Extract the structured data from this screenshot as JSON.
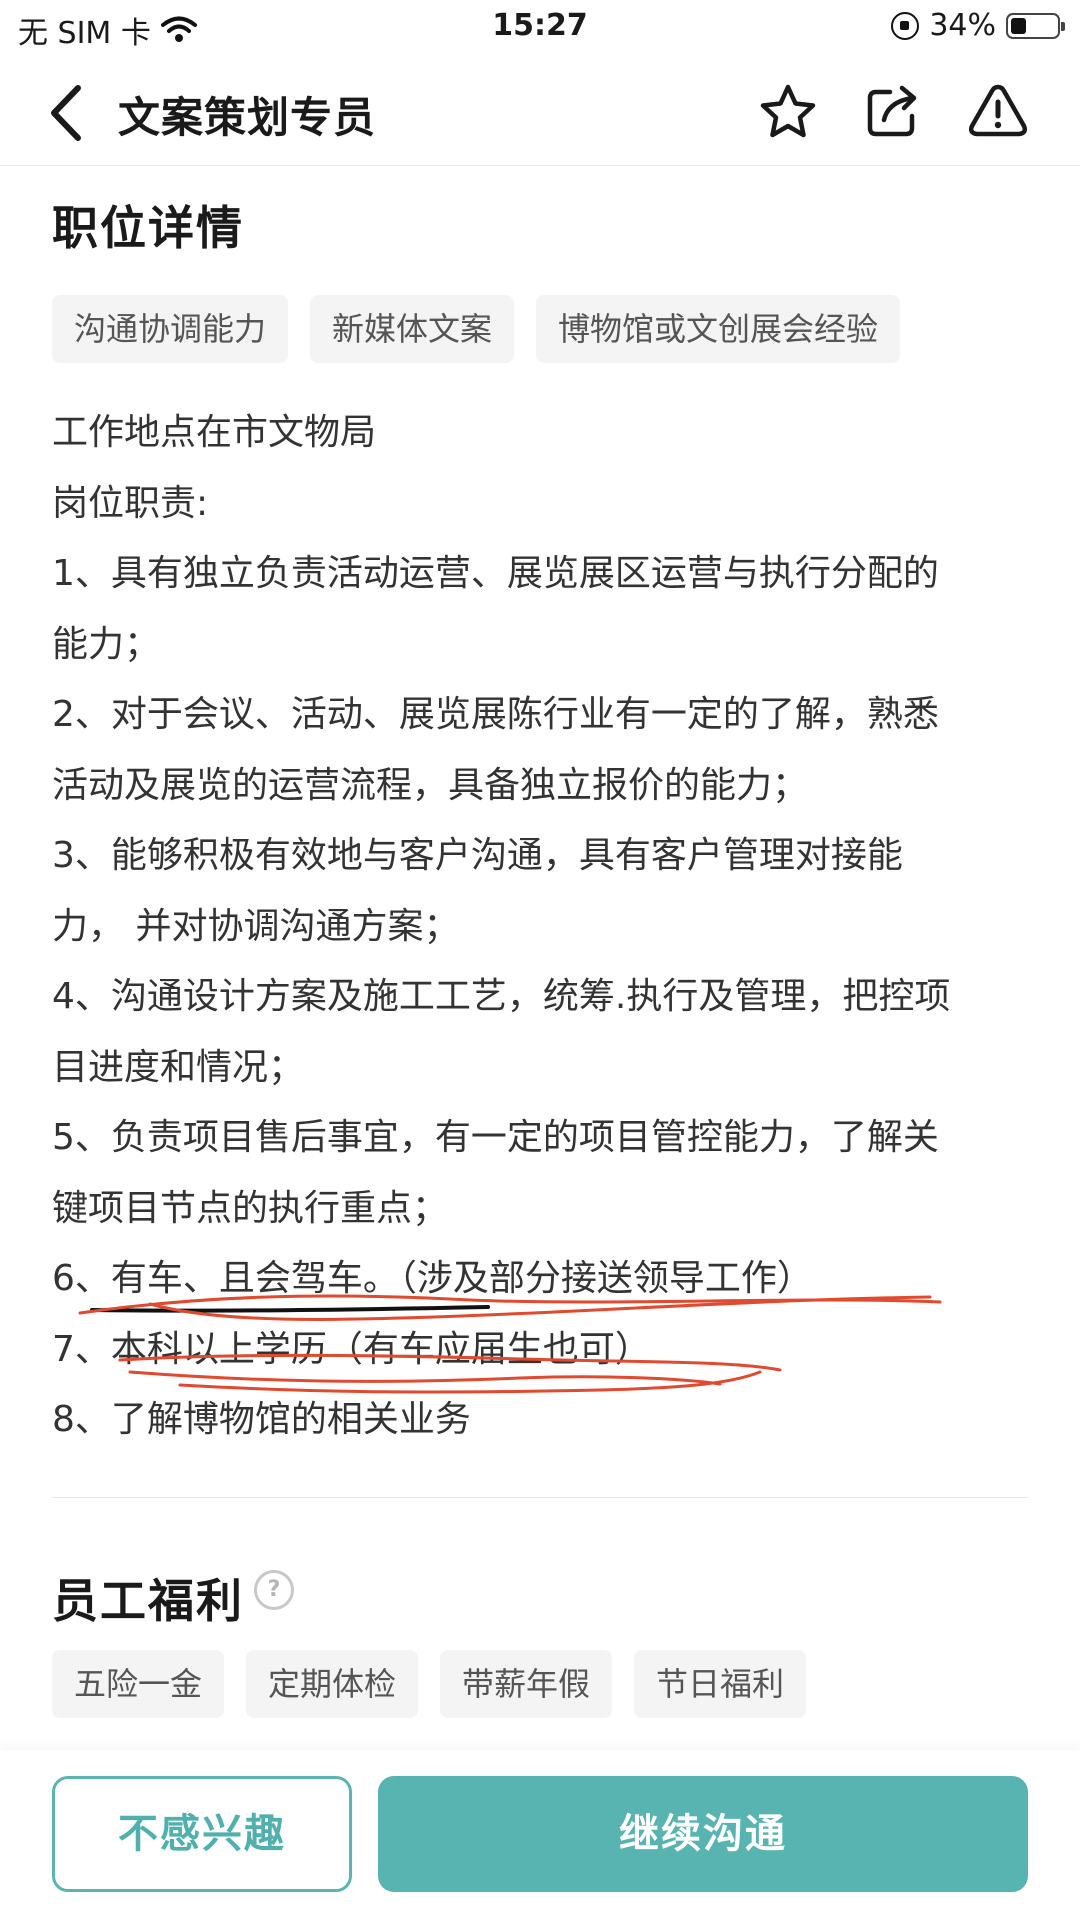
{
  "status_bar": {
    "carrier": "无 SIM 卡",
    "time": "15:27",
    "battery": "34%",
    "battery_level": 0.34
  },
  "nav": {
    "title": "文案策划专员",
    "icons": [
      "back-arrow-icon",
      "star-icon",
      "share-icon",
      "warning-icon"
    ]
  },
  "job_details": {
    "title": "职位详情",
    "tags": [
      "沟通协调能力",
      "新媒体文案",
      "博物馆或文创展会经验"
    ],
    "description_lines": [
      "工作地点在市文物局",
      "岗位职责:",
      "1、具有独立负责活动运营、展览展区运营与执行分配的",
      "能力；",
      "2、对于会议、活动、展览展陈行业有一定的了解，熟悉",
      "活动及展览的运营流程，具备独立报价的能力；",
      "3、能够积极有效地与客户沟通，具有客户管理对接能",
      "力， 并对协调沟通方案；",
      "4、沟通设计方案及施工工艺，统筹.执行及管理，把控项",
      "目进度和情况；",
      "5、负责项目售后事宜，有一定的项目管控能力，了解关",
      "键项目节点的执行重点；",
      "6、有车、且会驾车。（涉及部分接送领导工作）",
      "7、本科以上学历（有车应届生也可）",
      "8、了解博物馆的相关业务"
    ]
  },
  "benefits": {
    "title": "员工福利",
    "help_icon": "question-circle-icon",
    "help_symbol": "?",
    "tags": [
      "五险一金",
      "定期体检",
      "带薪年假",
      "节日福利"
    ]
  },
  "actions": {
    "not_interested": "不感兴趣",
    "continue_chat": "继续沟通"
  },
  "colors": {
    "accent": "#58b4b1",
    "tag_bg": "#f4f4f4",
    "annotation_red": "#e04a2f"
  }
}
